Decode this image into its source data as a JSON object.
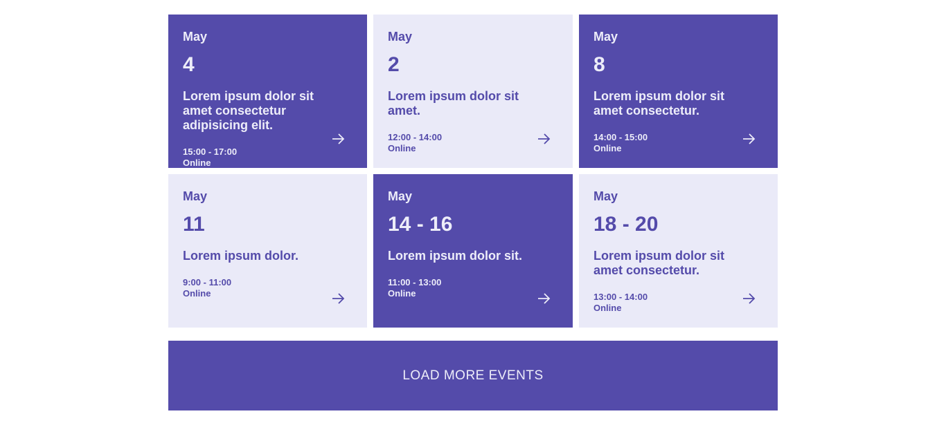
{
  "colors": {
    "primary": "#544BAA",
    "light": "#EAEAF8",
    "text_on_primary": "#EDEDF9"
  },
  "events": [
    {
      "month": "May",
      "day": "4",
      "title": "Lorem ipsum dolor sit amet consectetur adipisicing elit.",
      "time": "15:00 - 17:00",
      "location": "Online",
      "style": "dark",
      "icon": "arrow-right-icon"
    },
    {
      "month": "May",
      "day": "2",
      "title": "Lorem ipsum dolor sit amet.",
      "time": "12:00 - 14:00",
      "location": "Online",
      "style": "light",
      "icon": "arrow-right-icon"
    },
    {
      "month": "May",
      "day": "8",
      "title": "Lorem ipsum dolor sit amet consectetur.",
      "time": "14:00 - 15:00",
      "location": "Online",
      "style": "dark",
      "icon": "arrow-right-icon"
    },
    {
      "month": "May",
      "day": "11",
      "title": "Lorem ipsum dolor.",
      "time": "9:00 - 11:00",
      "location": "Online",
      "style": "light",
      "icon": "arrow-right-icon"
    },
    {
      "month": "May",
      "day": "14 - 16",
      "title": "Lorem ipsum dolor sit.",
      "time": "11:00 - 13:00",
      "location": "Online",
      "style": "dark",
      "icon": "arrow-right-icon"
    },
    {
      "month": "May",
      "day": "18 - 20",
      "title": "Lorem ipsum dolor sit amet consectetur.",
      "time": "13:00 - 14:00",
      "location": "Online",
      "style": "light",
      "icon": "arrow-right-icon"
    }
  ],
  "load_more_label": "LOAD MORE EVENTS"
}
